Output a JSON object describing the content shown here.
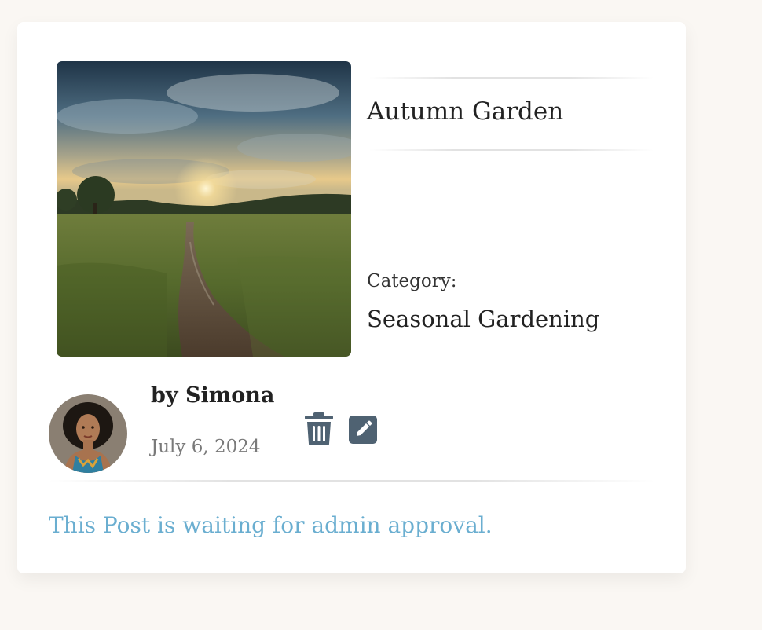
{
  "post": {
    "title": "Autumn Garden",
    "category_label": "Category:",
    "category": "Seasonal Gardening",
    "author": "by Simona",
    "date": "July 6, 2024",
    "status_message": "This Post is waiting for admin approval."
  },
  "actions": {
    "delete_icon": "trash-icon",
    "edit_icon": "pencil-square-icon"
  },
  "colors": {
    "background": "#faf7f3",
    "card": "#ffffff",
    "icon": "#4f6272",
    "status_text": "#6aaed0",
    "date_text": "#7a7a7a"
  }
}
